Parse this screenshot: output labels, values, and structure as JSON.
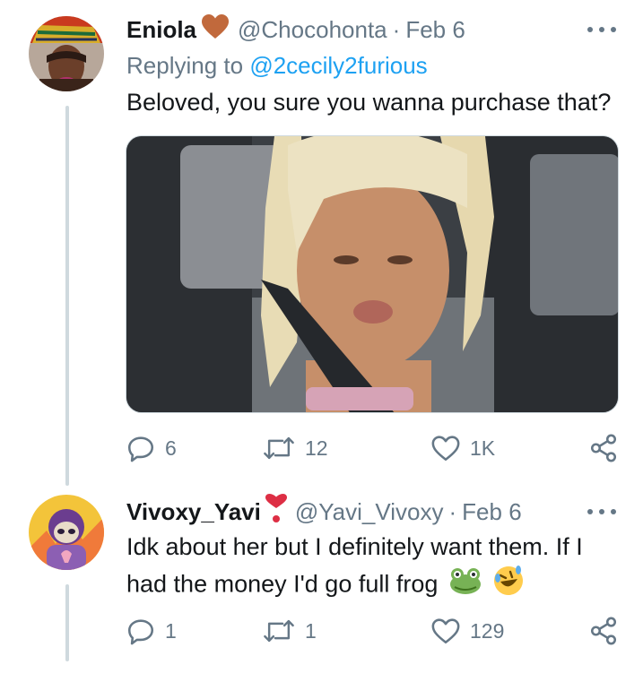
{
  "tweets": [
    {
      "author_name": "Eniola",
      "author_emoji": "heart-emoji",
      "handle": "@Chocohonta",
      "separator": "·",
      "date": "Feb 6",
      "replying_prefix": "Replying to",
      "replying_to": "@2cecily2furious",
      "text": "Beloved, you sure you wanna purchase that?",
      "counts": {
        "replies": "6",
        "retweets": "12",
        "likes": "1K"
      }
    },
    {
      "author_name": "Vivoxy_Yavi",
      "author_emoji": "exclamation-heart-emoji",
      "handle": "@Yavi_Vivoxy",
      "separator": "·",
      "date": "Feb 6",
      "text": "Idk about her but I definitely want them. If I had the money I'd go full frog",
      "text_emojis": [
        "frog-emoji",
        "rolling-laughing-emoji"
      ],
      "counts": {
        "replies": "1",
        "retweets": "1",
        "likes": "129"
      }
    }
  ],
  "colors": {
    "text": "#14171a",
    "secondary": "#657786",
    "link": "#1da1f2",
    "thread_line": "#cfd9de",
    "heart_emoji": "#c1693c",
    "red_heart": "#dd2e44"
  },
  "icons": [
    "reply-icon",
    "retweet-icon",
    "like-icon",
    "share-icon",
    "more-icon"
  ]
}
